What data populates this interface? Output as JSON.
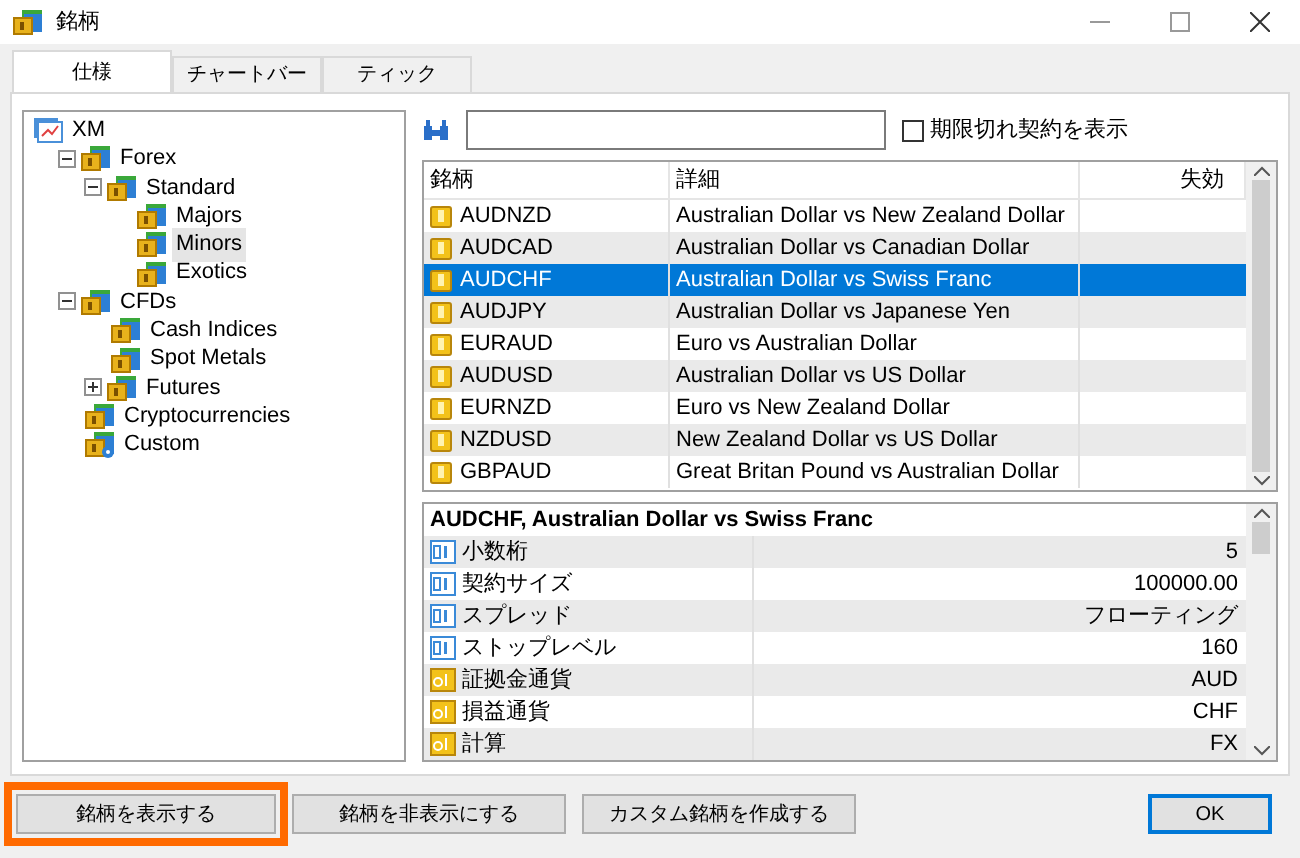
{
  "window": {
    "title": "銘柄"
  },
  "tabs": [
    {
      "label": "仕様",
      "selected": true
    },
    {
      "label": "チャートバー",
      "selected": false
    },
    {
      "label": "ティック",
      "selected": false
    }
  ],
  "tree": [
    {
      "label": "XM",
      "kind": "root",
      "children": [
        {
          "label": "Forex",
          "kind": "folder",
          "expanded": true,
          "selected": false,
          "children": [
            {
              "label": "Standard",
              "kind": "folder",
              "expanded": true,
              "selected": false,
              "children": [
                {
                  "label": "Majors",
                  "kind": "folder",
                  "selected": false
                },
                {
                  "label": "Minors",
                  "kind": "folder",
                  "selected": true
                },
                {
                  "label": "Exotics",
                  "kind": "folder",
                  "selected": false
                }
              ]
            }
          ]
        },
        {
          "label": "CFDs",
          "kind": "folder",
          "expanded": true,
          "selected": false,
          "children": [
            {
              "label": "Cash Indices",
              "kind": "folder",
              "selected": false
            },
            {
              "label": "Spot Metals",
              "kind": "folder",
              "selected": false
            },
            {
              "label": "Futures",
              "kind": "folder",
              "expanded": false,
              "selected": false
            }
          ]
        },
        {
          "label": "Cryptocurrencies",
          "kind": "folder",
          "selected": false
        },
        {
          "label": "Custom",
          "kind": "custom",
          "selected": false
        }
      ]
    }
  ],
  "show_expired": {
    "label": "期限切れ契約を表示",
    "checked": false
  },
  "symbols": {
    "columns": [
      "銘柄",
      "詳細",
      "失効"
    ],
    "rows": [
      {
        "symbol": "AUDNZD",
        "description": "Australian Dollar vs New Zealand Dollar",
        "selected": false
      },
      {
        "symbol": "AUDCAD",
        "description": "Australian Dollar vs Canadian Dollar",
        "selected": false
      },
      {
        "symbol": "AUDCHF",
        "description": "Australian Dollar vs Swiss Franc",
        "selected": true
      },
      {
        "symbol": "AUDJPY",
        "description": "Australian Dollar vs Japanese Yen",
        "selected": false
      },
      {
        "symbol": "EURAUD",
        "description": "Euro vs Australian Dollar",
        "selected": false
      },
      {
        "symbol": "AUDUSD",
        "description": "Australian Dollar vs US Dollar",
        "selected": false
      },
      {
        "symbol": "EURNZD",
        "description": "Euro vs New Zealand Dollar",
        "selected": false
      },
      {
        "symbol": "NZDUSD",
        "description": "New Zealand Dollar vs US Dollar",
        "selected": false
      },
      {
        "symbol": "GBPAUD",
        "description": "Great Britan Pound vs Australian Dollar",
        "selected": false
      }
    ]
  },
  "details": {
    "title": "AUDCHF, Australian Dollar vs Swiss Franc",
    "rows": [
      {
        "name": "小数桁",
        "value": "5",
        "kind": "number"
      },
      {
        "name": "契約サイズ",
        "value": "100000.00",
        "kind": "number"
      },
      {
        "name": "スプレッド",
        "value": "フローティング",
        "kind": "number"
      },
      {
        "name": "ストップレベル",
        "value": "160",
        "kind": "number"
      },
      {
        "name": "証拠金通貨",
        "value": "AUD",
        "kind": "text"
      },
      {
        "name": "損益通貨",
        "value": "CHF",
        "kind": "text"
      },
      {
        "name": "計算",
        "value": "FX",
        "kind": "text"
      }
    ]
  },
  "buttons": [
    {
      "label": "銘柄を表示する",
      "highlighted": true,
      "default": false
    },
    {
      "label": "銘柄を非表示にする",
      "highlighted": false,
      "default": false
    },
    {
      "label": "カスタム銘柄を作成する",
      "highlighted": false,
      "default": false
    },
    {
      "label": "OK",
      "highlighted": false,
      "default": true
    }
  ]
}
